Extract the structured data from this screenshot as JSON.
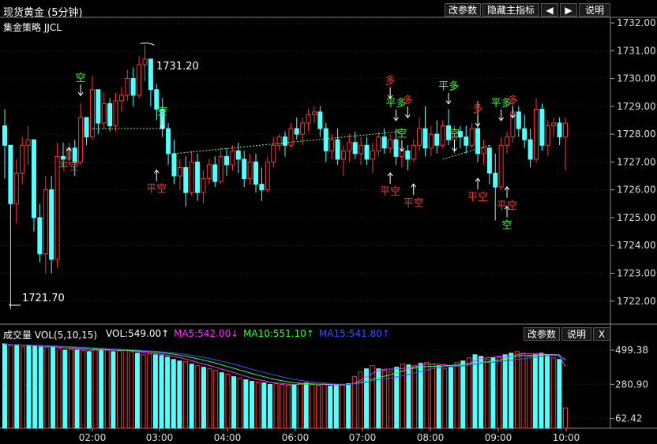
{
  "window": {
    "title": "现货黄金 (5分钟)"
  },
  "toolbar": {
    "modify_params": "改参数",
    "hide_main_indicator": "隐藏主指标",
    "prev_icon": "left-arrow-icon",
    "next_icon": "right-arrow-icon",
    "help": "说明"
  },
  "main_panel": {
    "indicator_name": "集金策略 JJCL",
    "high_label": "1731.20",
    "low_label": "1721.70"
  },
  "volume_panel": {
    "label": "成交量 VOL(5,10,15)",
    "vol": "VOL:549.00↑",
    "ma5": "MA5:542.00↓",
    "ma10": "MA10:551.10↑",
    "ma15": "MA15:541.80↑",
    "modify_params": "改参数",
    "help": "说明",
    "close": "X"
  },
  "colors": {
    "up": "#ff3333",
    "down": "#54ffff",
    "ma5": "#ff33ff",
    "ma10": "#33ff33",
    "ma15": "#3355ff",
    "grid": "#555555",
    "signal_red": "#ff3333",
    "signal_green": "#33ff33"
  },
  "chart_data": [
    {
      "type": "candlestick",
      "title": "现货黄金 (5分钟)",
      "y_ticks": [
        "1732.00",
        "1731.00",
        "1730.00",
        "1729.00",
        "1728.00",
        "1727.00",
        "1726.00",
        "1725.00",
        "1724.00",
        "1723.00",
        "1722.00"
      ],
      "ylim": [
        1721.2,
        1732.2
      ],
      "x_ticks": [
        "02:00",
        "03:00",
        "04:00",
        "06:00",
        "07:00",
        "08:00",
        "09:00",
        "10:00"
      ],
      "candles": [
        [
          1728.3,
          1728.9,
          1726.4,
          1727.6
        ],
        [
          1727.6,
          1727.6,
          1721.7,
          1725.5
        ],
        [
          1725.5,
          1727.1,
          1724.8,
          1726.6
        ],
        [
          1726.6,
          1727.9,
          1726.2,
          1727.6
        ],
        [
          1727.6,
          1728.3,
          1726.9,
          1727.8
        ],
        [
          1727.8,
          1727.8,
          1724.5,
          1725.0
        ],
        [
          1725.0,
          1725.5,
          1723.4,
          1723.7
        ],
        [
          1723.7,
          1726.5,
          1723.0,
          1726.0
        ],
        [
          1726.0,
          1726.5,
          1723.0,
          1723.5
        ],
        [
          1723.5,
          1727.7,
          1723.2,
          1727.2
        ],
        [
          1727.2,
          1727.7,
          1726.8,
          1727.1
        ],
        [
          1727.1,
          1727.7,
          1726.9,
          1727.5
        ],
        [
          1727.5,
          1727.8,
          1726.5,
          1727.0
        ],
        [
          1727.0,
          1729.1,
          1726.9,
          1728.6
        ],
        [
          1728.6,
          1728.6,
          1727.6,
          1727.9
        ],
        [
          1727.9,
          1730.1,
          1727.8,
          1729.6
        ],
        [
          1729.6,
          1729.6,
          1728.0,
          1728.4
        ],
        [
          1728.4,
          1729.5,
          1728.2,
          1729.1
        ],
        [
          1729.1,
          1729.3,
          1728.1,
          1728.3
        ],
        [
          1728.3,
          1729.5,
          1728.1,
          1729.2
        ],
        [
          1729.2,
          1729.7,
          1728.8,
          1729.4
        ],
        [
          1729.4,
          1730.3,
          1729.2,
          1730.0
        ],
        [
          1730.0,
          1730.4,
          1729.0,
          1729.4
        ],
        [
          1729.4,
          1730.8,
          1729.3,
          1730.5
        ],
        [
          1730.5,
          1731.2,
          1729.9,
          1730.7
        ],
        [
          1730.7,
          1730.7,
          1729.0,
          1729.6
        ],
        [
          1729.6,
          1729.8,
          1728.5,
          1728.9
        ],
        [
          1728.9,
          1729.3,
          1727.9,
          1728.2
        ],
        [
          1728.2,
          1728.4,
          1726.9,
          1727.3
        ],
        [
          1727.3,
          1727.8,
          1726.2,
          1726.5
        ],
        [
          1726.5,
          1727.1,
          1726.0,
          1726.8
        ],
        [
          1726.8,
          1727.2,
          1725.4,
          1725.9
        ],
        [
          1725.9,
          1727.4,
          1725.8,
          1727.0
        ],
        [
          1727.0,
          1727.3,
          1725.6,
          1725.9
        ],
        [
          1725.9,
          1726.7,
          1725.5,
          1726.4
        ],
        [
          1726.4,
          1727.1,
          1726.2,
          1726.9
        ],
        [
          1726.9,
          1727.2,
          1726.1,
          1726.3
        ],
        [
          1726.3,
          1727.5,
          1726.2,
          1727.2
        ],
        [
          1727.2,
          1727.5,
          1726.5,
          1726.9
        ],
        [
          1726.9,
          1727.6,
          1726.7,
          1727.4
        ],
        [
          1727.4,
          1727.7,
          1726.6,
          1727.1
        ],
        [
          1727.1,
          1727.4,
          1726.1,
          1726.4
        ],
        [
          1726.4,
          1727.3,
          1726.2,
          1727.0
        ],
        [
          1727.0,
          1727.3,
          1725.9,
          1726.2
        ],
        [
          1726.2,
          1726.8,
          1725.6,
          1726.0
        ],
        [
          1726.0,
          1727.2,
          1725.9,
          1727.0
        ],
        [
          1727.0,
          1727.9,
          1726.8,
          1727.6
        ],
        [
          1727.6,
          1728.0,
          1727.4,
          1727.9
        ],
        [
          1727.9,
          1728.1,
          1727.2,
          1727.6
        ],
        [
          1727.6,
          1728.4,
          1727.5,
          1728.2
        ],
        [
          1728.2,
          1728.6,
          1727.8,
          1728.0
        ],
        [
          1728.0,
          1728.6,
          1727.6,
          1728.4
        ],
        [
          1728.4,
          1728.9,
          1728.1,
          1728.7
        ],
        [
          1728.7,
          1729.0,
          1728.4,
          1728.8
        ],
        [
          1728.8,
          1729.0,
          1727.9,
          1728.2
        ],
        [
          1728.2,
          1728.4,
          1727.0,
          1727.4
        ],
        [
          1727.4,
          1728.0,
          1727.1,
          1727.8
        ],
        [
          1727.8,
          1728.2,
          1726.9,
          1727.1
        ],
        [
          1727.1,
          1727.6,
          1726.5,
          1727.4
        ],
        [
          1727.4,
          1728.0,
          1727.0,
          1727.7
        ],
        [
          1727.7,
          1728.1,
          1727.1,
          1727.3
        ],
        [
          1727.3,
          1727.9,
          1726.9,
          1727.6
        ],
        [
          1727.6,
          1727.9,
          1726.9,
          1727.1
        ],
        [
          1727.1,
          1727.7,
          1726.6,
          1727.4
        ],
        [
          1727.4,
          1728.1,
          1727.2,
          1727.9
        ],
        [
          1727.9,
          1728.2,
          1727.3,
          1727.5
        ],
        [
          1727.5,
          1728.0,
          1727.3,
          1727.8
        ],
        [
          1727.8,
          1728.2,
          1726.9,
          1727.2
        ],
        [
          1727.2,
          1727.6,
          1726.8,
          1727.4
        ],
        [
          1727.4,
          1727.6,
          1726.7,
          1727.1
        ],
        [
          1727.1,
          1727.8,
          1727.0,
          1727.6
        ],
        [
          1727.6,
          1728.6,
          1727.4,
          1728.2
        ],
        [
          1728.2,
          1729.0,
          1727.2,
          1727.5
        ],
        [
          1727.5,
          1728.3,
          1727.2,
          1728.0
        ],
        [
          1728.0,
          1728.5,
          1727.3,
          1727.6
        ],
        [
          1727.6,
          1728.5,
          1727.5,
          1728.3
        ],
        [
          1728.3,
          1728.9,
          1727.6,
          1727.8
        ],
        [
          1727.8,
          1728.3,
          1727.3,
          1728.1
        ],
        [
          1728.1,
          1728.3,
          1727.5,
          1727.9
        ],
        [
          1727.9,
          1728.3,
          1727.3,
          1727.6
        ],
        [
          1727.6,
          1728.4,
          1727.5,
          1728.2
        ],
        [
          1728.2,
          1729.2,
          1727.0,
          1727.3
        ],
        [
          1727.3,
          1727.8,
          1726.9,
          1727.5
        ],
        [
          1727.5,
          1727.6,
          1726.2,
          1726.6
        ],
        [
          1726.6,
          1727.3,
          1724.9,
          1726.1
        ],
        [
          1726.1,
          1727.9,
          1726.0,
          1727.6
        ],
        [
          1727.6,
          1728.1,
          1727.3,
          1727.9
        ],
        [
          1727.9,
          1729.1,
          1727.7,
          1728.8
        ],
        [
          1728.8,
          1729.0,
          1727.9,
          1728.2
        ],
        [
          1728.2,
          1728.7,
          1727.5,
          1727.8
        ],
        [
          1727.8,
          1728.2,
          1726.8,
          1727.1
        ],
        [
          1727.1,
          1729.3,
          1727.0,
          1728.9
        ],
        [
          1728.9,
          1729.1,
          1727.4,
          1727.6
        ],
        [
          1727.6,
          1728.5,
          1727.2,
          1728.3
        ],
        [
          1728.3,
          1728.6,
          1727.9,
          1728.4
        ],
        [
          1728.4,
          1728.6,
          1727.6,
          1727.9
        ],
        [
          1727.9,
          1728.6,
          1726.7,
          1728.4
        ]
      ],
      "signals": [
        {
          "label": "空",
          "i": 13,
          "price": 1729.9,
          "color": "green",
          "pos": "above"
        },
        {
          "label": "平空",
          "i": 11,
          "price": 1727.0,
          "color": "red",
          "pos": "below"
        },
        {
          "label": "空",
          "i": 27,
          "price": 1728.7,
          "color": "green",
          "pos": "above"
        },
        {
          "label": "平空",
          "i": 26,
          "price": 1726.2,
          "color": "red",
          "pos": "below"
        },
        {
          "label": "多",
          "i": 66,
          "price": 1729.8,
          "color": "red",
          "pos": "above"
        },
        {
          "label": "平多",
          "i": 67,
          "price": 1729.0,
          "color": "green",
          "pos": "above"
        },
        {
          "label": "多",
          "i": 69,
          "price": 1729.1,
          "color": "red",
          "pos": "above"
        },
        {
          "label": "空",
          "i": 68,
          "price": 1727.9,
          "color": "green",
          "pos": "above"
        },
        {
          "label": "平空",
          "i": 66,
          "price": 1726.1,
          "color": "red",
          "pos": "below"
        },
        {
          "label": "平空",
          "i": 70,
          "price": 1725.7,
          "color": "red",
          "pos": "below"
        },
        {
          "label": "平多",
          "i": 76,
          "price": 1729.6,
          "color": "green",
          "pos": "above"
        },
        {
          "label": "空",
          "i": 77,
          "price": 1727.9,
          "color": "green",
          "pos": "above"
        },
        {
          "label": "多",
          "i": 81,
          "price": 1728.8,
          "color": "red",
          "pos": "above"
        },
        {
          "label": "平空",
          "i": 81,
          "price": 1725.9,
          "color": "red",
          "pos": "below"
        },
        {
          "label": "平多",
          "i": 85,
          "price": 1729.0,
          "color": "green",
          "pos": "above"
        },
        {
          "label": "多",
          "i": 87,
          "price": 1729.1,
          "color": "red",
          "pos": "above"
        },
        {
          "label": "平空",
          "i": 86,
          "price": 1725.6,
          "color": "red",
          "pos": "below"
        },
        {
          "label": "空",
          "i": 86,
          "price": 1724.9,
          "color": "green",
          "pos": "below"
        }
      ],
      "dashed_lines": [
        {
          "from": 15,
          "to": 27,
          "price": 1728.2
        },
        {
          "from": 29,
          "to": 68,
          "price1": 1727.3,
          "price2": 1728.1
        },
        {
          "from": 75,
          "to": 83,
          "price1": 1727.1,
          "price2": 1727.6
        }
      ]
    },
    {
      "type": "bar",
      "title": "成交量 VOL(5,10,15)",
      "y_ticks": [
        "499.38",
        "280.90",
        "62.42"
      ],
      "ylim": [
        0,
        560
      ],
      "volumes": [
        540,
        530,
        535,
        520,
        530,
        525,
        520,
        515,
        520,
        510,
        500,
        505,
        500,
        495,
        490,
        510,
        505,
        500,
        490,
        495,
        500,
        490,
        480,
        470,
        475,
        470,
        465,
        455,
        440,
        430,
        425,
        410,
        400,
        390,
        380,
        370,
        355,
        345,
        330,
        320,
        310,
        300,
        295,
        290,
        280,
        285,
        280,
        275,
        280,
        285,
        290,
        280,
        275,
        280,
        270,
        275,
        280,
        285,
        330,
        360,
        380,
        400,
        380,
        370,
        360,
        390,
        410,
        405,
        400,
        415,
        420,
        410,
        400,
        380,
        390,
        420,
        430,
        450,
        470,
        460,
        440,
        450,
        460,
        470,
        480,
        490,
        480,
        460,
        470,
        480,
        470,
        450,
        440,
        130
      ],
      "up": [
        0,
        1,
        0,
        1,
        0,
        0,
        0,
        1,
        0,
        1,
        0,
        1,
        0,
        1,
        0,
        1,
        0,
        1,
        0,
        1,
        1,
        1,
        0,
        1,
        1,
        0,
        0,
        0,
        0,
        0,
        1,
        0,
        1,
        0,
        1,
        1,
        0,
        1,
        0,
        1,
        0,
        0,
        1,
        0,
        0,
        1,
        1,
        1,
        0,
        1,
        0,
        1,
        1,
        1,
        0,
        0,
        1,
        0,
        1,
        1,
        0,
        1,
        0,
        1,
        1,
        0,
        1,
        0,
        1,
        0,
        1,
        1,
        0,
        1,
        0,
        1,
        0,
        1,
        0,
        0,
        1,
        0,
        1,
        0,
        0,
        1,
        1,
        1,
        0,
        0,
        0,
        1,
        0,
        1,
        1,
        0,
        1
      ],
      "ma5_label": "MA5:542.00",
      "ma10_label": "MA10:551.10",
      "ma15_label": "MA15:541.80"
    }
  ]
}
